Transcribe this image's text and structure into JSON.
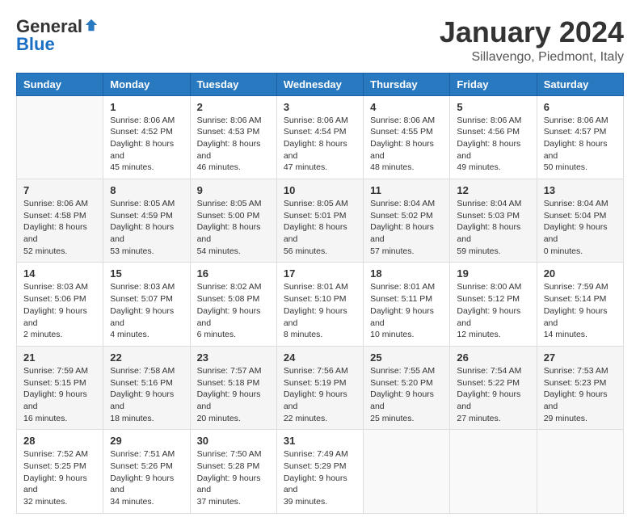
{
  "header": {
    "logo": {
      "general": "General",
      "blue": "Blue"
    },
    "title": "January 2024",
    "subtitle": "Sillavengo, Piedmont, Italy"
  },
  "calendar": {
    "days_of_week": [
      "Sunday",
      "Monday",
      "Tuesday",
      "Wednesday",
      "Thursday",
      "Friday",
      "Saturday"
    ],
    "weeks": [
      [
        {
          "day": "",
          "empty": true
        },
        {
          "day": "1",
          "sunrise": "Sunrise: 8:06 AM",
          "sunset": "Sunset: 4:52 PM",
          "daylight": "Daylight: 8 hours and 45 minutes."
        },
        {
          "day": "2",
          "sunrise": "Sunrise: 8:06 AM",
          "sunset": "Sunset: 4:53 PM",
          "daylight": "Daylight: 8 hours and 46 minutes."
        },
        {
          "day": "3",
          "sunrise": "Sunrise: 8:06 AM",
          "sunset": "Sunset: 4:54 PM",
          "daylight": "Daylight: 8 hours and 47 minutes."
        },
        {
          "day": "4",
          "sunrise": "Sunrise: 8:06 AM",
          "sunset": "Sunset: 4:55 PM",
          "daylight": "Daylight: 8 hours and 48 minutes."
        },
        {
          "day": "5",
          "sunrise": "Sunrise: 8:06 AM",
          "sunset": "Sunset: 4:56 PM",
          "daylight": "Daylight: 8 hours and 49 minutes."
        },
        {
          "day": "6",
          "sunrise": "Sunrise: 8:06 AM",
          "sunset": "Sunset: 4:57 PM",
          "daylight": "Daylight: 8 hours and 50 minutes."
        }
      ],
      [
        {
          "day": "7",
          "sunrise": "Sunrise: 8:06 AM",
          "sunset": "Sunset: 4:58 PM",
          "daylight": "Daylight: 8 hours and 52 minutes."
        },
        {
          "day": "8",
          "sunrise": "Sunrise: 8:05 AM",
          "sunset": "Sunset: 4:59 PM",
          "daylight": "Daylight: 8 hours and 53 minutes."
        },
        {
          "day": "9",
          "sunrise": "Sunrise: 8:05 AM",
          "sunset": "Sunset: 5:00 PM",
          "daylight": "Daylight: 8 hours and 54 minutes."
        },
        {
          "day": "10",
          "sunrise": "Sunrise: 8:05 AM",
          "sunset": "Sunset: 5:01 PM",
          "daylight": "Daylight: 8 hours and 56 minutes."
        },
        {
          "day": "11",
          "sunrise": "Sunrise: 8:04 AM",
          "sunset": "Sunset: 5:02 PM",
          "daylight": "Daylight: 8 hours and 57 minutes."
        },
        {
          "day": "12",
          "sunrise": "Sunrise: 8:04 AM",
          "sunset": "Sunset: 5:03 PM",
          "daylight": "Daylight: 8 hours and 59 minutes."
        },
        {
          "day": "13",
          "sunrise": "Sunrise: 8:04 AM",
          "sunset": "Sunset: 5:04 PM",
          "daylight": "Daylight: 9 hours and 0 minutes."
        }
      ],
      [
        {
          "day": "14",
          "sunrise": "Sunrise: 8:03 AM",
          "sunset": "Sunset: 5:06 PM",
          "daylight": "Daylight: 9 hours and 2 minutes."
        },
        {
          "day": "15",
          "sunrise": "Sunrise: 8:03 AM",
          "sunset": "Sunset: 5:07 PM",
          "daylight": "Daylight: 9 hours and 4 minutes."
        },
        {
          "day": "16",
          "sunrise": "Sunrise: 8:02 AM",
          "sunset": "Sunset: 5:08 PM",
          "daylight": "Daylight: 9 hours and 6 minutes."
        },
        {
          "day": "17",
          "sunrise": "Sunrise: 8:01 AM",
          "sunset": "Sunset: 5:10 PM",
          "daylight": "Daylight: 9 hours and 8 minutes."
        },
        {
          "day": "18",
          "sunrise": "Sunrise: 8:01 AM",
          "sunset": "Sunset: 5:11 PM",
          "daylight": "Daylight: 9 hours and 10 minutes."
        },
        {
          "day": "19",
          "sunrise": "Sunrise: 8:00 AM",
          "sunset": "Sunset: 5:12 PM",
          "daylight": "Daylight: 9 hours and 12 minutes."
        },
        {
          "day": "20",
          "sunrise": "Sunrise: 7:59 AM",
          "sunset": "Sunset: 5:14 PM",
          "daylight": "Daylight: 9 hours and 14 minutes."
        }
      ],
      [
        {
          "day": "21",
          "sunrise": "Sunrise: 7:59 AM",
          "sunset": "Sunset: 5:15 PM",
          "daylight": "Daylight: 9 hours and 16 minutes."
        },
        {
          "day": "22",
          "sunrise": "Sunrise: 7:58 AM",
          "sunset": "Sunset: 5:16 PM",
          "daylight": "Daylight: 9 hours and 18 minutes."
        },
        {
          "day": "23",
          "sunrise": "Sunrise: 7:57 AM",
          "sunset": "Sunset: 5:18 PM",
          "daylight": "Daylight: 9 hours and 20 minutes."
        },
        {
          "day": "24",
          "sunrise": "Sunrise: 7:56 AM",
          "sunset": "Sunset: 5:19 PM",
          "daylight": "Daylight: 9 hours and 22 minutes."
        },
        {
          "day": "25",
          "sunrise": "Sunrise: 7:55 AM",
          "sunset": "Sunset: 5:20 PM",
          "daylight": "Daylight: 9 hours and 25 minutes."
        },
        {
          "day": "26",
          "sunrise": "Sunrise: 7:54 AM",
          "sunset": "Sunset: 5:22 PM",
          "daylight": "Daylight: 9 hours and 27 minutes."
        },
        {
          "day": "27",
          "sunrise": "Sunrise: 7:53 AM",
          "sunset": "Sunset: 5:23 PM",
          "daylight": "Daylight: 9 hours and 29 minutes."
        }
      ],
      [
        {
          "day": "28",
          "sunrise": "Sunrise: 7:52 AM",
          "sunset": "Sunset: 5:25 PM",
          "daylight": "Daylight: 9 hours and 32 minutes."
        },
        {
          "day": "29",
          "sunrise": "Sunrise: 7:51 AM",
          "sunset": "Sunset: 5:26 PM",
          "daylight": "Daylight: 9 hours and 34 minutes."
        },
        {
          "day": "30",
          "sunrise": "Sunrise: 7:50 AM",
          "sunset": "Sunset: 5:28 PM",
          "daylight": "Daylight: 9 hours and 37 minutes."
        },
        {
          "day": "31",
          "sunrise": "Sunrise: 7:49 AM",
          "sunset": "Sunset: 5:29 PM",
          "daylight": "Daylight: 9 hours and 39 minutes."
        },
        {
          "day": "",
          "empty": true
        },
        {
          "day": "",
          "empty": true
        },
        {
          "day": "",
          "empty": true
        }
      ]
    ]
  }
}
